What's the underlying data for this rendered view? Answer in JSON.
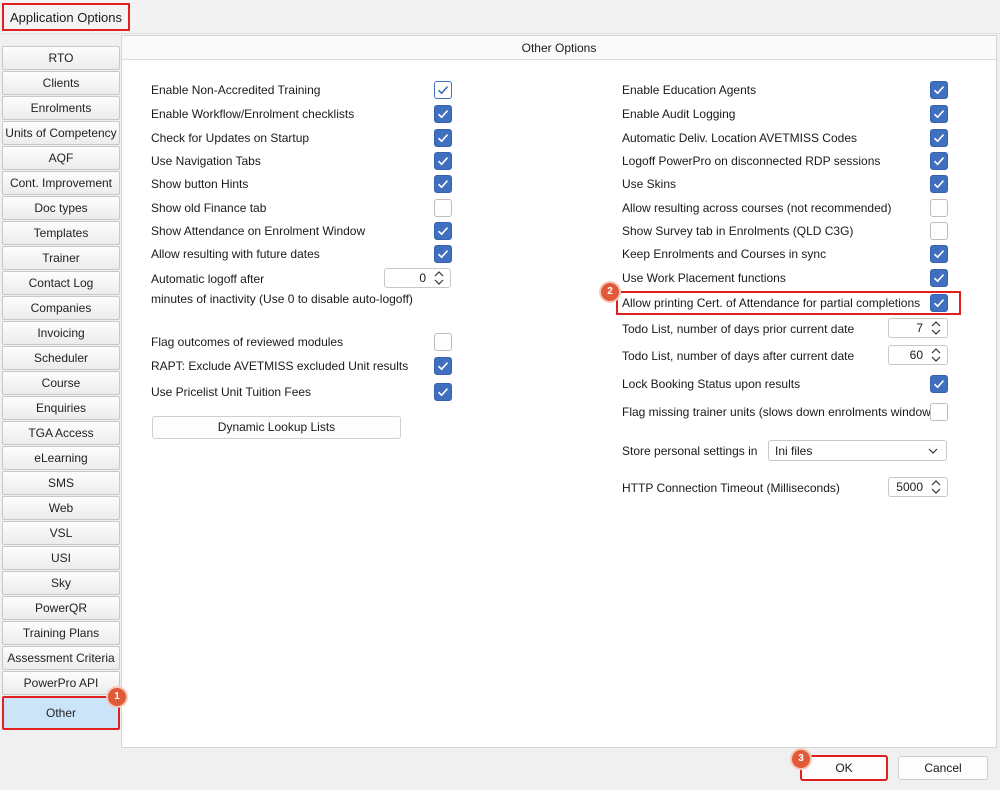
{
  "window": {
    "title": "Application Options"
  },
  "sidebar": {
    "items": [
      {
        "label": "RTO"
      },
      {
        "label": "Clients"
      },
      {
        "label": "Enrolments"
      },
      {
        "label": "Units of Competency"
      },
      {
        "label": "AQF"
      },
      {
        "label": "Cont. Improvement"
      },
      {
        "label": "Doc types"
      },
      {
        "label": "Templates"
      },
      {
        "label": "Trainer"
      },
      {
        "label": "Contact Log"
      },
      {
        "label": "Companies"
      },
      {
        "label": "Invoicing"
      },
      {
        "label": "Scheduler"
      },
      {
        "label": "Course"
      },
      {
        "label": "Enquiries"
      },
      {
        "label": "TGA Access"
      },
      {
        "label": "eLearning"
      },
      {
        "label": "SMS"
      },
      {
        "label": "Web"
      },
      {
        "label": "VSL"
      },
      {
        "label": "USI"
      },
      {
        "label": "Sky"
      },
      {
        "label": "PowerQR"
      },
      {
        "label": "Training Plans"
      },
      {
        "label": "Assessment Criteria"
      },
      {
        "label": "PowerPro API"
      }
    ],
    "active_label": "Other"
  },
  "panel": {
    "title": "Other Options"
  },
  "left": {
    "options": [
      {
        "label": "Enable Non-Accredited Training",
        "checked": true
      },
      {
        "label": "Enable Workflow/Enrolment checklists",
        "checked": true
      },
      {
        "label": "Check for Updates on Startup",
        "checked": true
      },
      {
        "label": "Use Navigation Tabs",
        "checked": true
      },
      {
        "label": "Show button Hints",
        "checked": true
      },
      {
        "label": "Show old Finance tab",
        "checked": false
      },
      {
        "label": "Show Attendance on Enrolment Window",
        "checked": true
      },
      {
        "label": "Allow resulting with future dates",
        "checked": true
      }
    ],
    "logoff_label_1": "Automatic logoff after",
    "logoff_label_2": "minutes of inactivity (Use 0 to disable auto-logoff)",
    "logoff_value": "0",
    "options2": [
      {
        "label": "Flag outcomes of reviewed modules",
        "checked": false
      },
      {
        "label": "RAPT: Exclude AVETMISS excluded Unit results",
        "checked": true
      },
      {
        "label": "Use Pricelist Unit Tuition Fees",
        "checked": true
      }
    ],
    "dynamic_button": "Dynamic Lookup Lists"
  },
  "right": {
    "options": [
      {
        "label": "Enable Education Agents",
        "checked": true
      },
      {
        "label": "Enable Audit Logging",
        "checked": true
      },
      {
        "label": "Automatic Deliv. Location AVETMISS Codes",
        "checked": true
      },
      {
        "label": "Logoff PowerPro on disconnected RDP sessions",
        "checked": true
      },
      {
        "label": "Use Skins",
        "checked": true
      },
      {
        "label": "Allow resulting across courses (not recommended)",
        "checked": false
      },
      {
        "label": "Show Survey tab in Enrolments (QLD C3G)",
        "checked": false
      },
      {
        "label": "Keep Enrolments and Courses in sync",
        "checked": true
      },
      {
        "label": "Use Work Placement functions",
        "checked": true
      },
      {
        "label": "Allow printing Cert. of Attendance for partial completions",
        "checked": true
      }
    ],
    "todo_prior_label": "Todo List, number of days prior current date",
    "todo_prior_value": "7",
    "todo_after_label": "Todo List, number of days after current date",
    "todo_after_value": "60",
    "lock_label": "Lock Booking Status upon results",
    "lock_checked": true,
    "flag_trainer_label": "Flag missing trainer units (slows down enrolments window)",
    "flag_trainer_checked": false,
    "store_label": "Store personal settings in",
    "store_value": "Ini files",
    "http_label": "HTTP Connection Timeout (Milliseconds)",
    "http_value": "5000"
  },
  "footer": {
    "ok_label": "OK",
    "cancel_label": "Cancel"
  },
  "annotations": {
    "badge1": "1",
    "badge2": "2",
    "badge3": "3"
  },
  "colors": {
    "checkbox_on": "#3f6fbe",
    "highlight_box": "#e02020",
    "badge": "#e05a3a",
    "active_nav": "#cce4f7"
  }
}
